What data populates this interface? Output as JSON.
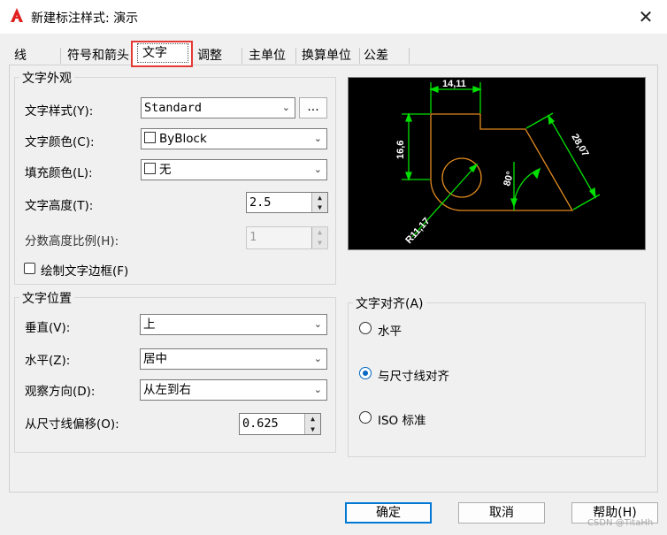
{
  "window": {
    "title": "新建标注样式: 演示",
    "close_glyph": "✕",
    "app_icon": "autocad-icon"
  },
  "tabs": [
    {
      "label": "线"
    },
    {
      "label": "符号和箭头"
    },
    {
      "label": "文字",
      "selected": true
    },
    {
      "label": "调整"
    },
    {
      "label": "主单位"
    },
    {
      "label": "换算单位"
    },
    {
      "label": "公差"
    }
  ],
  "appearance": {
    "title": "文字外观",
    "style_label": "文字样式(Y):",
    "style_value": "Standard",
    "style_browse": "...",
    "color_label": "文字颜色(C):",
    "color_value": "ByBlock",
    "fill_label": "填充颜色(L):",
    "fill_value": "无",
    "height_label": "文字高度(T):",
    "height_value": "2.5",
    "fraction_label": "分数高度比例(H):",
    "fraction_value": "1",
    "frame_label": "绘制文字边框(F)",
    "frame_checked": false
  },
  "placement": {
    "title": "文字位置",
    "vertical_label": "垂直(V):",
    "vertical_value": "上",
    "horizontal_label": "水平(Z):",
    "horizontal_value": "居中",
    "view_label": "观察方向(D):",
    "view_value": "从左到右",
    "offset_label": "从尺寸线偏移(O):",
    "offset_value": "0.625"
  },
  "alignment": {
    "title": "文字对齐(A)",
    "options": [
      {
        "label": "水平",
        "selected": false
      },
      {
        "label": "与尺寸线对齐",
        "selected": true
      },
      {
        "label": "ISO 标准",
        "selected": false
      }
    ]
  },
  "preview": {
    "dim_top": "14,11",
    "dim_left": "16,6",
    "dim_diag": "28,07",
    "dim_angle": "80°",
    "dim_radius": "R11,17",
    "geometry_color": "#e08a1e",
    "dim_color": "#00e000"
  },
  "buttons": {
    "ok": "确定",
    "cancel": "取消",
    "help": "帮助(H)"
  },
  "watermark": "CSDN @TitaHh"
}
